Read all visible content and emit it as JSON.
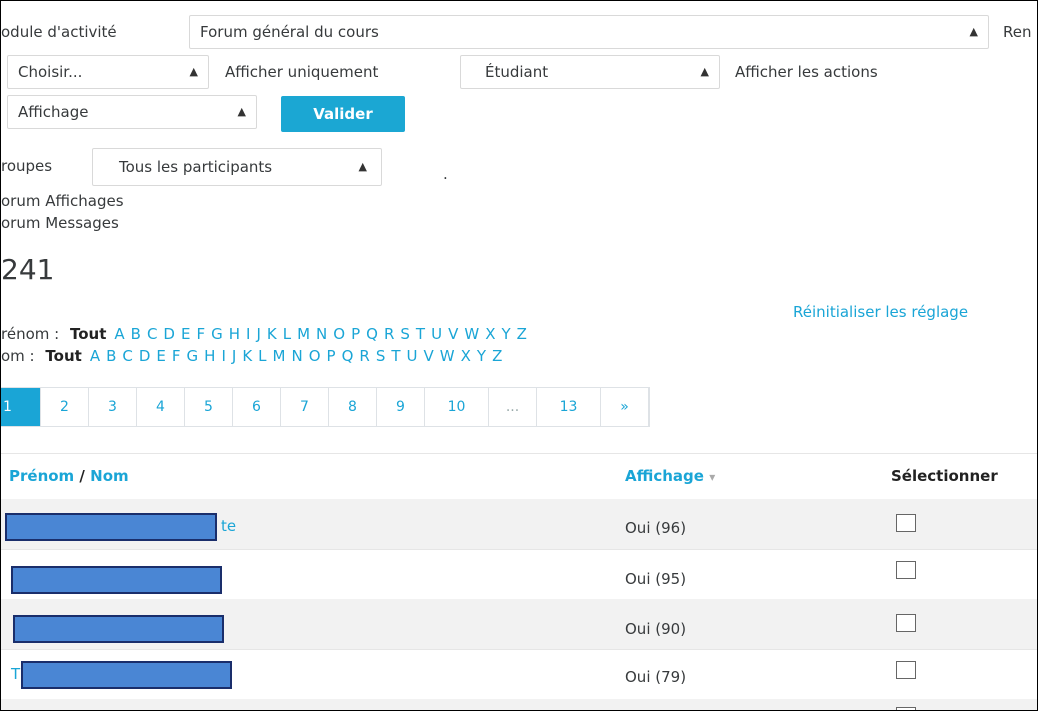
{
  "filters": {
    "activity_module_label": "odule d'activité",
    "activity_module_value": "Forum général du cours",
    "right_cut_label": "Ren",
    "choose_value": "Choisir...",
    "show_only_label": "Afficher uniquement",
    "role_value": "Étudiant",
    "show_actions_label": "Afficher les actions",
    "display_value": "Affichage",
    "validate_button": "Valider",
    "groups_label": "roupes",
    "groups_value": "Tous les participants",
    "dot": "."
  },
  "stats": {
    "forum_views": "orum Affichages",
    "forum_messages": "orum Messages",
    "total": "241"
  },
  "reset_link": "Réinitialiser les réglage",
  "letter_filters": {
    "firstname_label": "rénom :",
    "lastname_label": "om :",
    "all": "Tout",
    "letters": [
      "A",
      "B",
      "C",
      "D",
      "E",
      "F",
      "G",
      "H",
      "I",
      "J",
      "K",
      "L",
      "M",
      "N",
      "O",
      "P",
      "Q",
      "R",
      "S",
      "T",
      "U",
      "V",
      "W",
      "X",
      "Y",
      "Z"
    ]
  },
  "pagination": {
    "pages": [
      "1",
      "2",
      "3",
      "4",
      "5",
      "6",
      "7",
      "8",
      "9",
      "10",
      "...",
      "13",
      "»"
    ],
    "active": "1"
  },
  "table": {
    "headers": {
      "firstname": "Prénom",
      "separator": "/",
      "lastname": "Nom",
      "views": "Affichage",
      "sort_icon": "▾",
      "select": "Sélectionner"
    },
    "rows": [
      {
        "name_suffix": "te",
        "views": "Oui (96)"
      },
      {
        "name_suffix": "",
        "views": "Oui (95)"
      },
      {
        "name_suffix": "",
        "views": "Oui (90)"
      },
      {
        "name_suffix": "T",
        "views": "Oui (79)"
      }
    ]
  },
  "colors": {
    "accent": "#1aa5d6",
    "button": "#1ba7d3",
    "redaction": "#4a86d4"
  }
}
